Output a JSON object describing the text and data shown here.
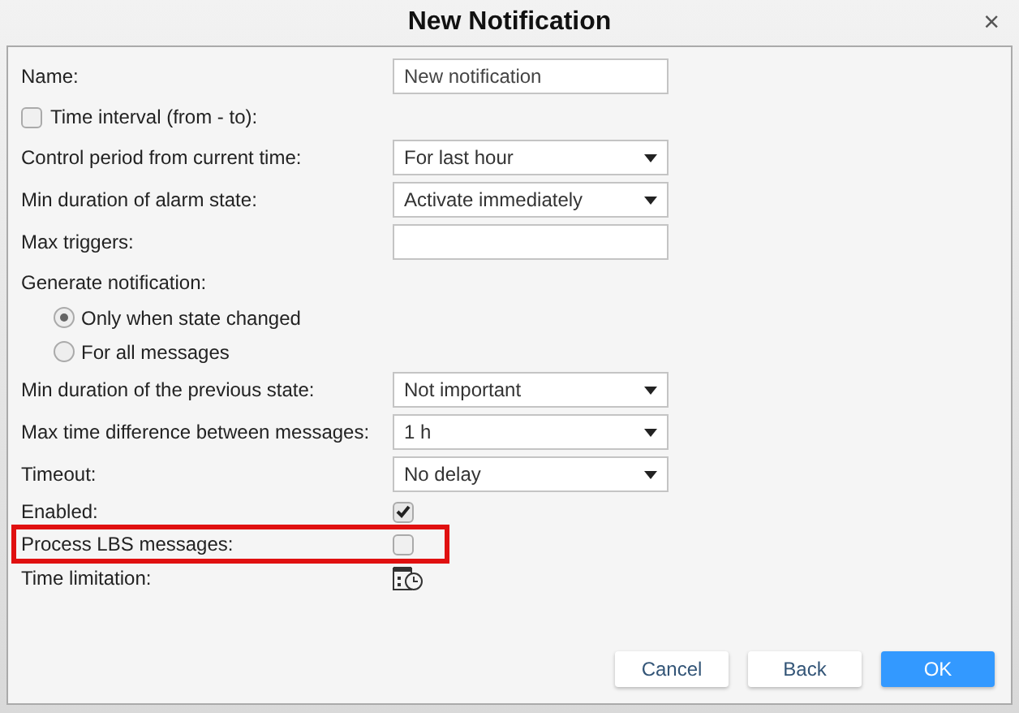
{
  "window": {
    "title": "New Notification",
    "close": "×"
  },
  "rows": [
    {
      "kind": "text",
      "label": "Name:",
      "value": "New notification"
    },
    {
      "kind": "check_label",
      "label": "Time interval (from - to):",
      "checked": false
    },
    {
      "kind": "select",
      "label": "Control period from current time:",
      "value": "For last hour"
    },
    {
      "kind": "select",
      "label": "Min duration of alarm state:",
      "value": "Activate immediately"
    },
    {
      "kind": "text",
      "label": "Max triggers:",
      "value": ""
    },
    {
      "kind": "heading",
      "label": "Generate notification:"
    },
    {
      "kind": "radio",
      "label": "Only when state changed",
      "selected": true
    },
    {
      "kind": "radio",
      "label": "For all messages",
      "selected": false
    },
    {
      "kind": "select",
      "label": "Min duration of the previous state:",
      "value": "Not important"
    },
    {
      "kind": "select",
      "label": "Max time difference between messages:",
      "value": "1 h"
    },
    {
      "kind": "select",
      "label": "Timeout:",
      "value": "No delay"
    },
    {
      "kind": "check",
      "label": "Enabled:",
      "checked": true,
      "highlighted": false
    },
    {
      "kind": "check",
      "label": "Process LBS messages:",
      "checked": false,
      "highlighted": true
    },
    {
      "kind": "schedule",
      "label": "Time limitation:"
    }
  ],
  "buttons": [
    {
      "label": "Cancel",
      "primary": false
    },
    {
      "label": "Back",
      "primary": false
    },
    {
      "label": "OK",
      "primary": true
    }
  ]
}
